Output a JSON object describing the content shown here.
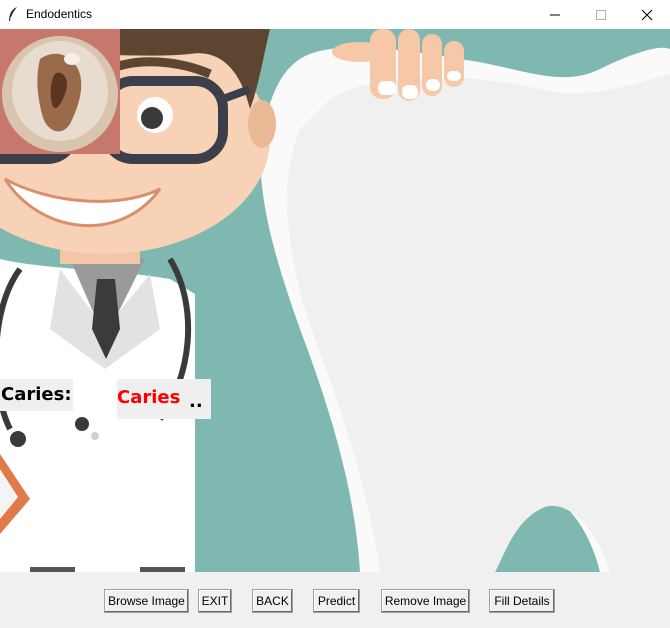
{
  "window": {
    "title": "Endodentics"
  },
  "main": {
    "caries_label": "Caries:",
    "caries_value": "Caries",
    "caries_suffix": ".."
  },
  "buttons": {
    "browse": "Browse Image",
    "exit": "EXIT",
    "back": "BACK",
    "predict": "Predict",
    "remove": "Remove Image",
    "fill": "Fill Details"
  },
  "colors": {
    "teal_background": "#7fb8b0",
    "result_text": "#ff0000"
  }
}
